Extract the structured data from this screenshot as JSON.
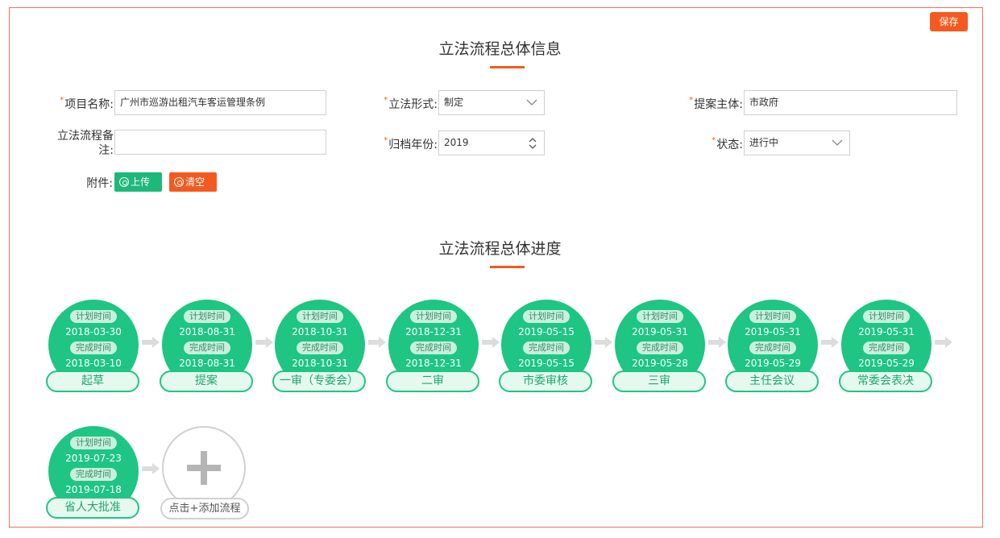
{
  "toolbar": {
    "save_label": "保存"
  },
  "info_section": {
    "title": "立法流程总体信息"
  },
  "progress_section": {
    "title": "立法流程总体进度"
  },
  "form": {
    "project_name": {
      "label": "项目名称:",
      "value": "广州市巡游出租汽车客运管理条例",
      "required": true
    },
    "form_type": {
      "label": "立法形式:",
      "value": "制定",
      "required": true
    },
    "proposer": {
      "label": "提案主体:",
      "value": "市政府",
      "required": true
    },
    "remark": {
      "label_line1": "立法流程备",
      "label_line2": "注:",
      "value": ""
    },
    "archive_year": {
      "label": "归档年份:",
      "value": "2019",
      "required": true
    },
    "status": {
      "label": "状态:",
      "value": "进行中",
      "required": true
    },
    "attachment": {
      "label": "附件:",
      "upload_label": "上传",
      "clear_label": "清空"
    }
  },
  "steps": [
    {
      "plan_label": "计划时间",
      "plan": "2018-03-30",
      "done_label": "完成时间",
      "done": "2018-03-10",
      "name": "起草"
    },
    {
      "plan_label": "计划时间",
      "plan": "2018-08-31",
      "done_label": "完成时间",
      "done": "2018-08-31",
      "name": "提案"
    },
    {
      "plan_label": "计划时间",
      "plan": "2018-10-31",
      "done_label": "完成时间",
      "done": "2018-10-31",
      "name": "一审（专委会）"
    },
    {
      "plan_label": "计划时间",
      "plan": "2018-12-31",
      "done_label": "完成时间",
      "done": "2018-12-31",
      "name": "二审"
    },
    {
      "plan_label": "计划时间",
      "plan": "2019-05-15",
      "done_label": "完成时间",
      "done": "2019-05-15",
      "name": "市委审核"
    },
    {
      "plan_label": "计划时间",
      "plan": "2019-05-31",
      "done_label": "完成时间",
      "done": "2019-05-28",
      "name": "三审"
    },
    {
      "plan_label": "计划时间",
      "plan": "2019-05-31",
      "done_label": "完成时间",
      "done": "2019-05-29",
      "name": "主任会议"
    },
    {
      "plan_label": "计划时间",
      "plan": "2019-05-31",
      "done_label": "完成时间",
      "done": "2019-05-29",
      "name": "常委会表决"
    },
    {
      "plan_label": "计划时间",
      "plan": "2019-07-23",
      "done_label": "完成时间",
      "done": "2019-07-18",
      "name": "省人大批准"
    }
  ],
  "add_step": {
    "label": "点击+添加流程"
  },
  "colors": {
    "accent": "#f45a1f",
    "step_green": "#1ec583",
    "upload_green": "#1db87a"
  },
  "icons": {
    "dropdown": "chevron-down-icon",
    "spinner": "updown-icon",
    "add": "plus-icon",
    "arrow": "arrow-right-icon"
  }
}
